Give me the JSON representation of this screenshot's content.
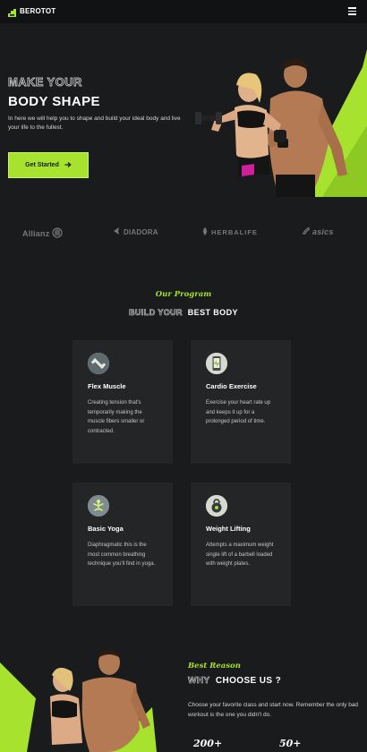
{
  "brand": {
    "name": "BEROTOT",
    "accent": "#a6e22e"
  },
  "nav": {
    "menu_icon": "hamburger-menu-icon"
  },
  "hero": {
    "title_line1": "MAKE YOUR",
    "title_line2": "BODY SHAPE",
    "description": "In here we will help you to shape and build your ideal body and live your life to the fullest.",
    "cta_label": "Get Started",
    "cta_icon": "arrow-right-icon"
  },
  "partners": [
    "Allianz",
    "DIADORA",
    "HERBALIFE",
    "asics"
  ],
  "program": {
    "subtitle": "Our Program",
    "heading_outline": "BUILD YOUR",
    "heading_solid": "BEST BODY",
    "cards": [
      {
        "icon": "dumbbell-icon",
        "title": "Flex Muscle",
        "text": "Creating tension that's temporarily making the muscle fibers smaller or contracted."
      },
      {
        "icon": "heart-rate-phone-icon",
        "title": "Cardio Exercise",
        "text": "Exercise your heart rate up and keeps it up for a prolonged period of time."
      },
      {
        "icon": "yoga-pose-icon",
        "title": "Basic Yoga",
        "text": "Diaphragmatic this is the most common breathing technique you'll find in yoga."
      },
      {
        "icon": "kettlebell-icon",
        "title": "Weight Lifting",
        "text": "Attempts a maximum weight single lift of a barbell loaded with weight plates."
      }
    ]
  },
  "reason": {
    "subtitle": "Best Reason",
    "heading_outline": "WHY",
    "heading_solid": "CHOOSE US ?",
    "description": "Choose your favorite class and start now. Remember the only bad workout is the one you didn't do.",
    "stats": [
      "200+",
      "50+"
    ]
  }
}
